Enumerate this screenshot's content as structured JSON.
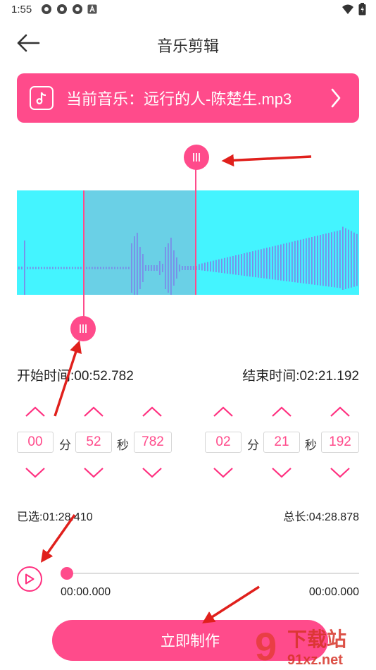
{
  "status_bar": {
    "time": "1:55"
  },
  "header": {
    "title": "音乐剪辑"
  },
  "music": {
    "label": "当前音乐：远行的人-陈楚生.mp3"
  },
  "colors": {
    "accent": "#ff4b8b",
    "wave_bg": "#44f4ff",
    "wave_selected": "#6ad0e6",
    "wave_bars": "#7a8ee8",
    "annotation": "#e0201c"
  },
  "times": {
    "start_label": "开始时间:00:52.782",
    "end_label": "结束时间:02:21.192"
  },
  "start_time": {
    "minutes": "00",
    "minutes_unit": "分",
    "seconds": "52",
    "seconds_unit": "秒",
    "ms": "782"
  },
  "end_time": {
    "minutes": "02",
    "minutes_unit": "分",
    "seconds": "21",
    "seconds_unit": "秒",
    "ms": "192"
  },
  "info": {
    "selected": "已选:01:28.410",
    "total": "总长:04:28.878"
  },
  "player": {
    "current": "00:00.000",
    "duration": "00:00.000",
    "progress": 0
  },
  "action": {
    "make_label": "立即制作"
  },
  "watermark": {
    "brand": "下载站",
    "site": "91xz.net",
    "logo": "9"
  }
}
